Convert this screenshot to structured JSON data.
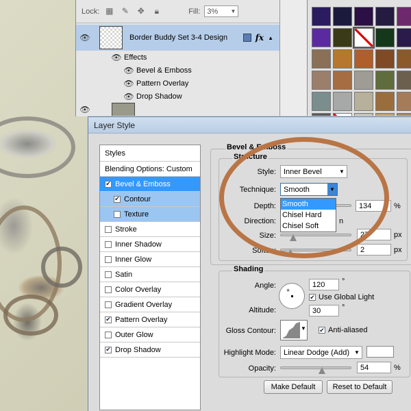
{
  "layers_panel": {
    "lock_label": "Lock:",
    "fill_label": "Fill:",
    "fill_value": "3%",
    "layer_name": "Border Buddy Set 3-4  Design",
    "fx_badge": "fx",
    "effects_label": "Effects",
    "effects": [
      "Bevel & Emboss",
      "Pattern Overlay",
      "Drop Shadow"
    ]
  },
  "swatch_colors": [
    "#2a1c5e",
    "#1c1a3c",
    "#2b0f45",
    "#231b40",
    "#6c2a6d",
    "#5b2aa0",
    "#3a3a18",
    "#ffffff",
    "#16381a",
    "#2a1b4a",
    "#8a7057",
    "#b5782e",
    "#b05e2b",
    "#7f4a25",
    "#8c5a2a",
    "#9b7f6b",
    "#a66d43",
    "#9f9c95",
    "#5f6c3c",
    "#6b5f4d",
    "#7a8e8e",
    "#a7a9a8",
    "#b7b09a",
    "#9a6e3c",
    "#a57c5a",
    "#5a5a5a",
    "#ffffff",
    "#c6c3b5",
    "#c2a06a",
    "#a58862"
  ],
  "dialog": {
    "title": "Layer Style",
    "styles_header": "Styles",
    "blending_options": "Blending Options: Custom",
    "styles": [
      {
        "label": "Bevel & Emboss",
        "checked": true,
        "state": "selected"
      },
      {
        "label": "Contour",
        "checked": true,
        "state": "sub"
      },
      {
        "label": "Texture",
        "checked": false,
        "state": "sub"
      },
      {
        "label": "Stroke",
        "checked": false,
        "state": ""
      },
      {
        "label": "Inner Shadow",
        "checked": false,
        "state": ""
      },
      {
        "label": "Inner Glow",
        "checked": false,
        "state": ""
      },
      {
        "label": "Satin",
        "checked": false,
        "state": ""
      },
      {
        "label": "Color Overlay",
        "checked": false,
        "state": ""
      },
      {
        "label": "Gradient Overlay",
        "checked": false,
        "state": ""
      },
      {
        "label": "Pattern Overlay",
        "checked": true,
        "state": ""
      },
      {
        "label": "Outer Glow",
        "checked": false,
        "state": ""
      },
      {
        "label": "Drop Shadow",
        "checked": true,
        "state": ""
      }
    ],
    "bevel_title": "Bevel & Emboss",
    "structure_title": "Structure",
    "style_label": "Style:",
    "style_value": "Inner Bevel",
    "technique_label": "Technique:",
    "technique_value": "Smooth",
    "technique_options": [
      "Smooth",
      "Chisel Hard",
      "Chisel Soft"
    ],
    "depth_label": "Depth:",
    "depth_value": "134",
    "direction_label": "Direction:",
    "direction_partial": "n",
    "size_label": "Size:",
    "size_value": "27",
    "soften_label": "Soften:",
    "soften_value": "2",
    "shading_title": "Shading",
    "angle_label": "Angle:",
    "angle_value": "120",
    "global_light_label": "Use Global Light",
    "altitude_label": "Altitude:",
    "altitude_value": "30",
    "gloss_label": "Gloss Contour:",
    "anti_aliased_label": "Anti-aliased",
    "highlight_label": "Highlight Mode:",
    "highlight_value": "Linear Dodge (Add)",
    "opacity_label": "Opacity:",
    "opacity_value": "54",
    "unit_percent": "%",
    "unit_px": "px",
    "unit_deg": "°",
    "make_default": "Make Default",
    "reset_default": "Reset to Default"
  }
}
